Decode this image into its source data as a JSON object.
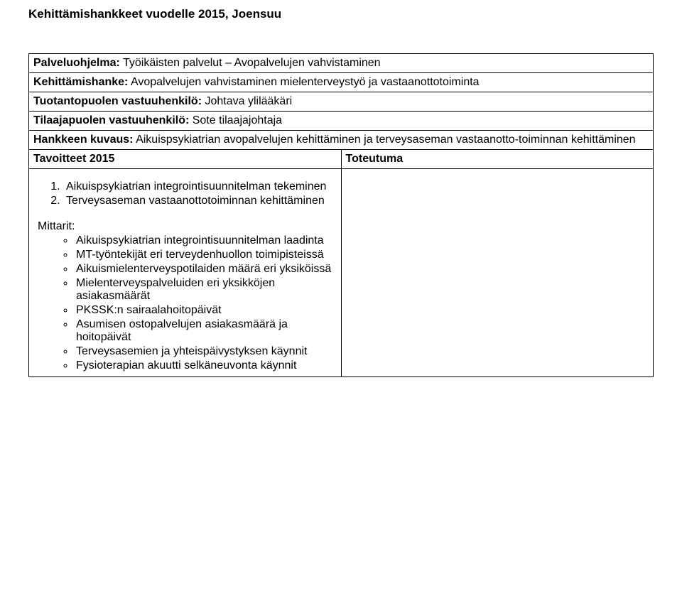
{
  "title": "Kehittämishankkeet vuodelle 2015, Joensuu",
  "rows": {
    "palveluohjelma_label": "Palveluohjelma:",
    "palveluohjelma_value": " Työikäisten palvelut – Avopalvelujen vahvistaminen",
    "kehittamishanke_label": "Kehittämishanke:",
    "kehittamishanke_value": " Avopalvelujen vahvistaminen mielenterveystyö ja vastaanottotoiminta",
    "tuotantopuolen_label": "Tuotantopuolen vastuuhenkilö:",
    "tuotantopuolen_value": " Johtava ylilääkäri",
    "tilaajapuolen_label": "Tilaajapuolen vastuuhenkilö:",
    "tilaajapuolen_value": " Sote tilaajajohtaja",
    "hankkeen_label": "Hankkeen kuvaus:",
    "hankkeen_value": " Aikuispsykiatrian avopalvelujen kehittäminen ja terveysaseman vastaanotto-toiminnan kehittäminen"
  },
  "tavoitteet_header": "Tavoitteet 2015",
  "toteutuma_header": "Toteutuma",
  "numbered": [
    "Aikuispsykiatrian integrointisuunnitelman tekeminen",
    "Terveysaseman vastaanottotoiminnan kehittäminen"
  ],
  "mittarit_label": "Mittarit:",
  "mittarit": [
    "Aikuispsykiatrian integrointisuunnitelman laadinta",
    "MT-työntekijät eri terveydenhuollon toimipisteissä",
    "Aikuismielenterveyspotilaiden määrä eri yksiköissä",
    "Mielenterveyspalveluiden eri yksikköjen asiakasmäärät",
    "PKSSK:n sairaalahoitopäivät",
    "Asumisen ostopalvelujen asiakasmäärä ja hoitopäivät",
    "Terveysasemien ja yhteispäivystyksen käynnit",
    "Fysioterapian akuutti selkäneuvonta käynnit"
  ]
}
